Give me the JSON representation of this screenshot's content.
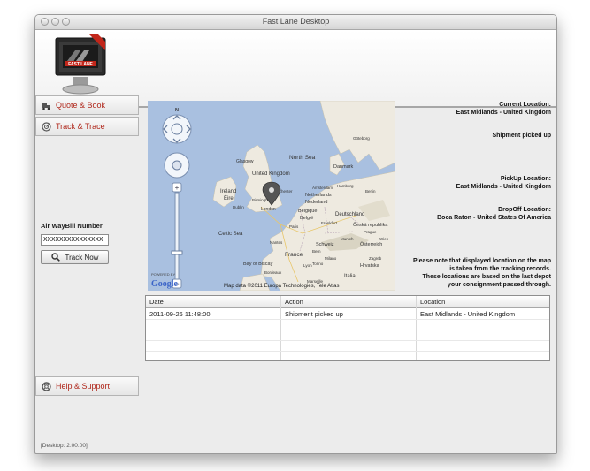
{
  "window": {
    "title": "Fast Lane Desktop"
  },
  "logo": {
    "text": "FAST LANE"
  },
  "nav": {
    "quote_book": "Quote & Book",
    "track_trace": "Track & Trace",
    "help_support": "Help & Support"
  },
  "tracking": {
    "awb_label": "Air WayBill Number",
    "awb_value": "XXXXXXXXXXXXXXX",
    "track_button": "Track Now"
  },
  "map": {
    "labels": [
      "North Sea",
      "Glasgow",
      "United Kingdom",
      "Manchester",
      "Birmingham",
      "London",
      "Ireland",
      "Éire",
      "Dublin",
      "Celtic Sea",
      "Bay of Biscay",
      "France",
      "Paris",
      "Nantes",
      "Belgique",
      "België",
      "Netherlands",
      "Nederland",
      "Amsterdam",
      "Danmark",
      "Hamburg",
      "Berlin",
      "Deutschland",
      "Česká republika",
      "Österreich",
      "Schweiz",
      "Hrvatska",
      "Italia",
      "Torino",
      "Milano",
      "Marseille",
      "Lyon",
      "Bordeaux",
      "Göteborg",
      "Prague",
      "Wien",
      "Zagreb",
      "Bern",
      "Frankfurt",
      "Munich"
    ],
    "attribution": "Map data ©2011 Europa Technologies, Tele Atlas",
    "powered_by": "POWERED BY",
    "google": "Google",
    "compass_n": "N",
    "colors": {
      "sea": "#a9c0e0",
      "land": "#eeeae0",
      "land_dark": "#d9d4c3",
      "marker": "#555555"
    }
  },
  "status": {
    "current_location_label": "Current Location:",
    "current_location_value": "East Midlands - United Kingdom",
    "shipment_status": "Shipment picked up",
    "pickup_label": "PickUp Location:",
    "pickup_value": "East Midlands - United Kingdom",
    "dropoff_label": "DropOff Location:",
    "dropoff_value": "Boca Raton - United States Of America",
    "note_lines": [
      "Please note that displayed location on the map",
      "is taken from the tracking records.",
      "These locations are based on the last depot",
      "your consignment passed through."
    ]
  },
  "table": {
    "columns": [
      "Date",
      "Action",
      "Location"
    ],
    "rows": [
      [
        "2011-09-26 11:48:00",
        "Shipment picked up",
        "East Midlands - United Kingdom"
      ]
    ]
  },
  "footer": {
    "version": "[Desktop: 2.00.00]"
  },
  "colors": {
    "accent": "#b0271b"
  }
}
